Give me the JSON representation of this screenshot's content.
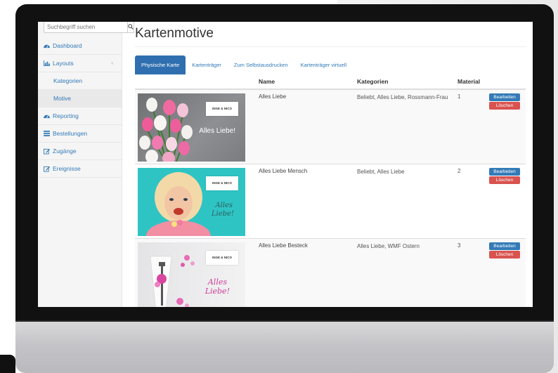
{
  "sidebar": {
    "search_placeholder": "Suchbegriff suchen",
    "items": [
      {
        "label": "Dashboard",
        "icon": "dashboard-icon"
      },
      {
        "label": "Layouts",
        "icon": "bar-chart-icon"
      },
      {
        "label": "Kategorien"
      },
      {
        "label": "Motive"
      },
      {
        "label": "Reporting",
        "icon": "dashboard-icon"
      },
      {
        "label": "Bestellungen",
        "icon": "list-icon"
      },
      {
        "label": "Zugänge",
        "icon": "edit-icon"
      },
      {
        "label": "Ereignisse",
        "icon": "edit-icon"
      }
    ]
  },
  "main": {
    "title": "Kartenmotive",
    "tabs": [
      {
        "label": "Physische Karte"
      },
      {
        "label": "Kartenträger"
      },
      {
        "label": "Zum Selbstausdrucken"
      },
      {
        "label": "Kartenträger virtuell"
      }
    ],
    "table": {
      "headers": {
        "name": "Name",
        "kategorien": "Kategorien",
        "material": "Material"
      },
      "rows": [
        {
          "name": "Alles Liebe",
          "kategorien": "Beliebt, Alles Liebe, Rossmann-Frau",
          "material": "1",
          "card_text": "Alles Liebe!",
          "brand": "INGE & NICO"
        },
        {
          "name": "Alles Liebe Mensch",
          "kategorien": "Beliebt, Alles Liebe",
          "material": "2",
          "card_text_1": "Alles",
          "card_text_2": "Liebe!",
          "brand": "INGE & NICO"
        },
        {
          "name": "Alles Liebe Besteck",
          "kategorien": "Alles Liebe, WMF Ostern",
          "material": "3",
          "card_text_1": "Alles",
          "card_text_2": "Liebe!",
          "brand": "INGE & NICO"
        }
      ],
      "edit_label": "Bearbeiten",
      "delete_label": "Löschen"
    }
  },
  "colors": {
    "accent": "#337ab7",
    "danger": "#d9534f",
    "sidebar_bg": "#f5f5f5",
    "bezel": "#111111"
  }
}
